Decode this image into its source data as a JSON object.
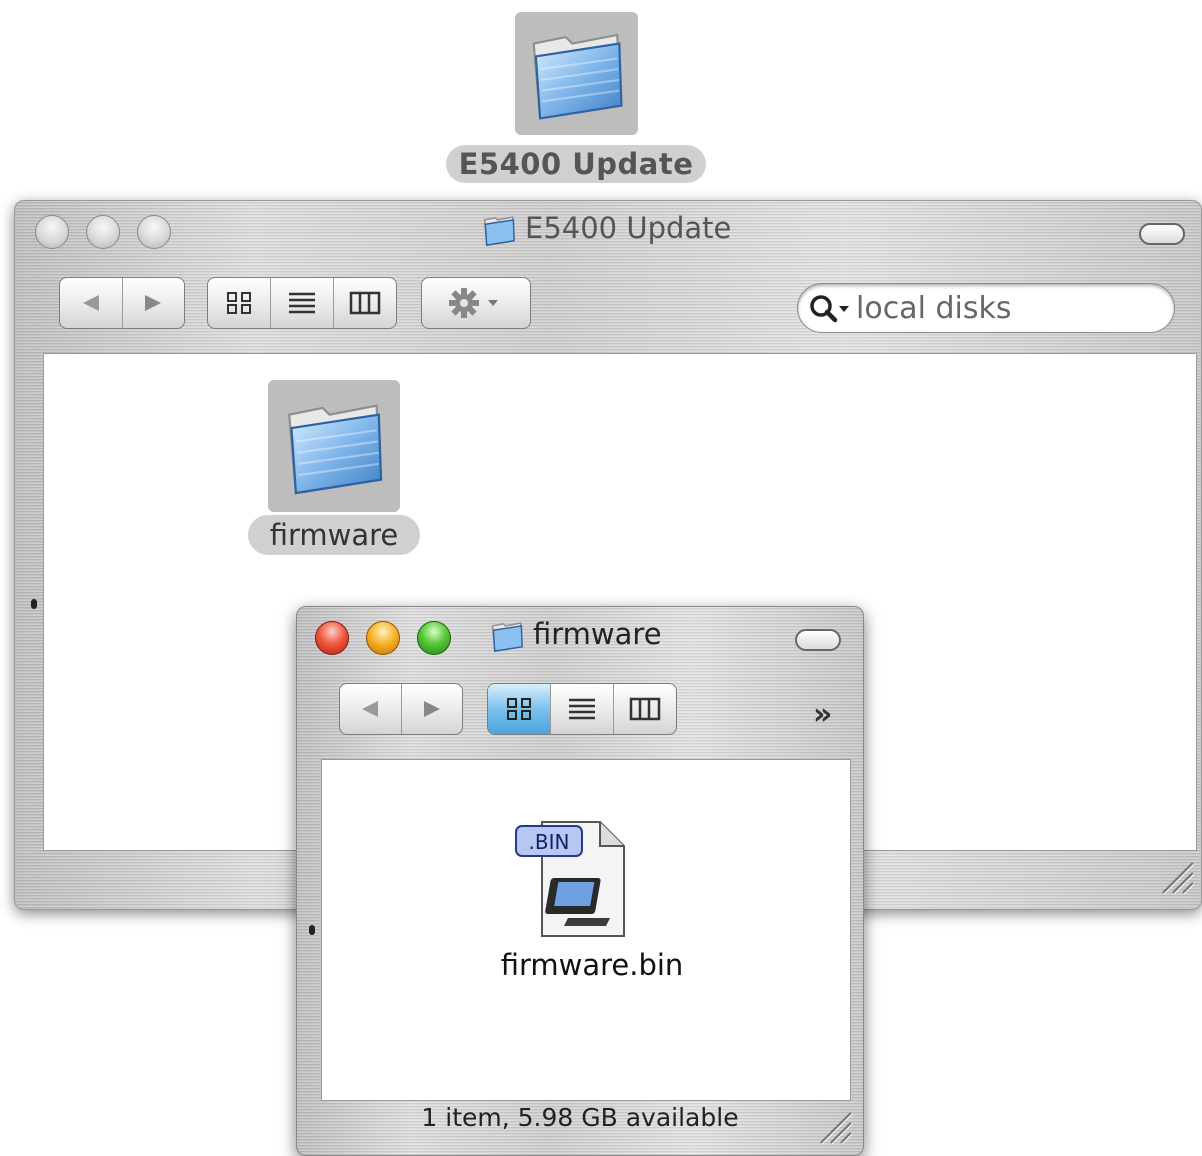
{
  "desktop": {
    "icon_name": "folder-icon",
    "label": "E5400 Update"
  },
  "main_window": {
    "title": "E5400 Update",
    "title_icon": "folder-icon",
    "nav": {
      "back_icon": "back-arrow-icon",
      "forward_icon": "forward-arrow-icon"
    },
    "view_buttons": [
      {
        "name": "icon-view-icon",
        "glyph": "▪▪"
      },
      {
        "name": "list-view-icon",
        "glyph": "≡"
      },
      {
        "name": "column-view-icon",
        "glyph": "▥"
      }
    ],
    "action_icon": "gear-icon",
    "search": {
      "placeholder": "local disks",
      "icon": "magnifier-icon"
    },
    "items": [
      {
        "label": "firmware",
        "icon": "folder-icon"
      }
    ]
  },
  "sub_window": {
    "title": "firmware",
    "title_icon": "folder-icon",
    "active_view": "icon",
    "overflow_glyph": "»",
    "items": [
      {
        "label": "firmware.bin",
        "icon": "bin-file-icon",
        "badge": ".BIN"
      }
    ],
    "status": "1 item, 5.98 GB available"
  },
  "colors": {
    "folder_blue": "#7fb6ea",
    "selection_grey": "#d0d0d0",
    "active_segment": "#4aa4de",
    "close_red": "#f05a40",
    "minimize_yellow": "#f7b42a",
    "zoom_green": "#58c83a"
  }
}
